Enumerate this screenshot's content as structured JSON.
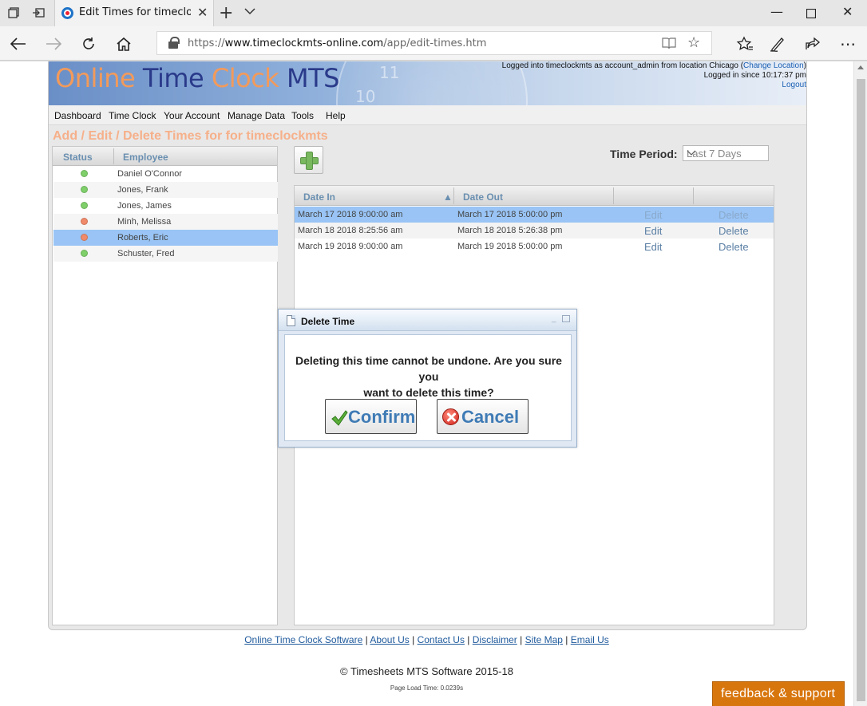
{
  "browser": {
    "tab_title": "Edit Times for timeclock",
    "url_prefix": "https://",
    "url_host": "www.timeclockmts-online.com",
    "url_path": "/app/edit-times.htm",
    "icons": [
      "tabs-icon",
      "set-aside-icon",
      "close-icon",
      "new-tab-icon",
      "tab-list-icon",
      "minimize-icon",
      "maximize-icon",
      "window-close-icon",
      "back-icon",
      "forward-icon",
      "refresh-icon",
      "home-icon",
      "lock-icon",
      "reading-view-icon",
      "favorite-star-icon",
      "favorites-icon",
      "pen-icon",
      "share-icon",
      "more-icon"
    ]
  },
  "header": {
    "logo": {
      "w1": "Online",
      "w2": "Time",
      "w3": "Clock",
      "w4": "MTS"
    },
    "login_line1_prefix": "Logged into timeclockmts as account_admin from location Chicago (",
    "change_location": "Change Location",
    "login_line1_suffix": ")",
    "login_line2": "Logged in since 10:17:37 pm",
    "logout": "Logout"
  },
  "menu": [
    "Dashboard",
    "Time Clock",
    "Your Account",
    "Manage Data",
    "Tools",
    "Help"
  ],
  "page_title": "Add / Edit / Delete Times for for timeclockmts",
  "employees": {
    "headers": {
      "status": "Status",
      "employee": "Employee"
    },
    "rows": [
      {
        "name": "Daniel O'Connor",
        "status_color": "#7fcf6a"
      },
      {
        "name": "Jones, Frank",
        "status_color": "#7fcf6a"
      },
      {
        "name": "Jones, James",
        "status_color": "#7fcf6a"
      },
      {
        "name": "Minh, Melissa",
        "status_color": "#f08a6a"
      },
      {
        "name": "Roberts, Eric",
        "status_color": "#f08a6a"
      },
      {
        "name": "Schuster, Fred",
        "status_color": "#7fcf6a"
      }
    ],
    "selected_index": 4
  },
  "time_period": {
    "label": "Time Period:",
    "value": "Last 7 Days"
  },
  "times": {
    "headers": {
      "date_in": "Date In",
      "date_out": "Date Out"
    },
    "rows": [
      {
        "date_in": "March 17 2018 9:00:00 am",
        "date_out": "March 17 2018 5:00:00 pm",
        "edit": "Edit",
        "delete": "Delete"
      },
      {
        "date_in": "March 18 2018 8:25:56 am",
        "date_out": "March 18 2018 5:26:38 pm",
        "edit": "Edit",
        "delete": "Delete"
      },
      {
        "date_in": "March 19 2018 9:00:00 am",
        "date_out": "March 19 2018 5:00:00 pm",
        "edit": "Edit",
        "delete": "Delete"
      }
    ],
    "selected_index": 0
  },
  "dialog": {
    "title": "Delete Time",
    "message_line1": "Deleting this time cannot be undone. Are you sure you",
    "message_line2": "want to delete this time?",
    "confirm": "Confirm",
    "cancel": "Cancel"
  },
  "footer": {
    "links": [
      "Online Time Clock Software",
      "About Us",
      "Contact Us",
      "Disclaimer",
      "Site Map",
      "Email Us"
    ],
    "separator": "|",
    "copyright": "© Timesheets MTS Software 2015-18",
    "load_time": "Page Load Time: 0.0239s",
    "feedback": "feedback & support"
  },
  "colors": {
    "accent": "#99c4f5",
    "title_orange": "#f6b08a",
    "feedback": "#d8760e",
    "link": "#1f5a9c"
  }
}
